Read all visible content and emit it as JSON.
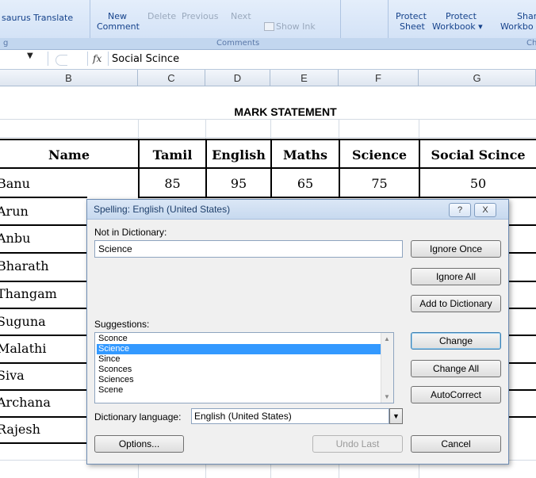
{
  "ribbon": {
    "proofing_partial": "saurus Translate",
    "proofing_group_partial": "g",
    "new_comment_line1": "New",
    "new_comment_line2": "Comment",
    "delete": "Delete",
    "previous": "Previous",
    "next": "Next",
    "show_ink": "Show Ink",
    "comments_group": "Comments",
    "protect_sheet_line1": "Protect",
    "protect_sheet_line2": "Sheet",
    "protect_workbook_line1": "Protect",
    "protect_workbook_line2": "Workbook",
    "share_line1": "Share",
    "share_line2": "Workbo",
    "changes_group_partial": "Ch"
  },
  "formula_bar": {
    "fx": "fx",
    "value": "Social Scince"
  },
  "columns": [
    "B",
    "C",
    "D",
    "E",
    "F",
    "G"
  ],
  "sheet": {
    "title": "MARK STATEMENT",
    "headers": [
      "Name",
      "Tamil",
      "English",
      "Maths",
      "Science",
      "Social Scince"
    ],
    "names": [
      "Banu",
      "Arun",
      "Anbu",
      "Bharath",
      "Thangam",
      "Suguna",
      "Malathi",
      "Siva",
      "Archana",
      "Rajesh"
    ],
    "first_row_marks": [
      "85",
      "95",
      "65",
      "75",
      "50"
    ]
  },
  "dialog": {
    "title": "Spelling: English (United States)",
    "help_icon": "?",
    "close_icon": "X",
    "not_in_dictionary_label": "Not in Dictionary:",
    "not_in_dictionary_value": "Science",
    "suggestions_label": "Suggestions:",
    "suggestions": [
      "Sconce",
      "Science",
      "Since",
      "Sconces",
      "Sciences",
      "Scene"
    ],
    "selected_suggestion": "Science",
    "dictionary_language_label": "Dictionary language:",
    "dictionary_language_value": "English (United States)",
    "buttons": {
      "ignore_once": "Ignore Once",
      "ignore_all": "Ignore All",
      "add_to_dictionary": "Add to Dictionary",
      "change": "Change",
      "change_all": "Change All",
      "autocorrect": "AutoCorrect",
      "options": "Options...",
      "undo_last": "Undo Last",
      "cancel": "Cancel"
    }
  },
  "colors": {
    "selection": "#3399ff",
    "ribbon_text": "#15428b"
  }
}
